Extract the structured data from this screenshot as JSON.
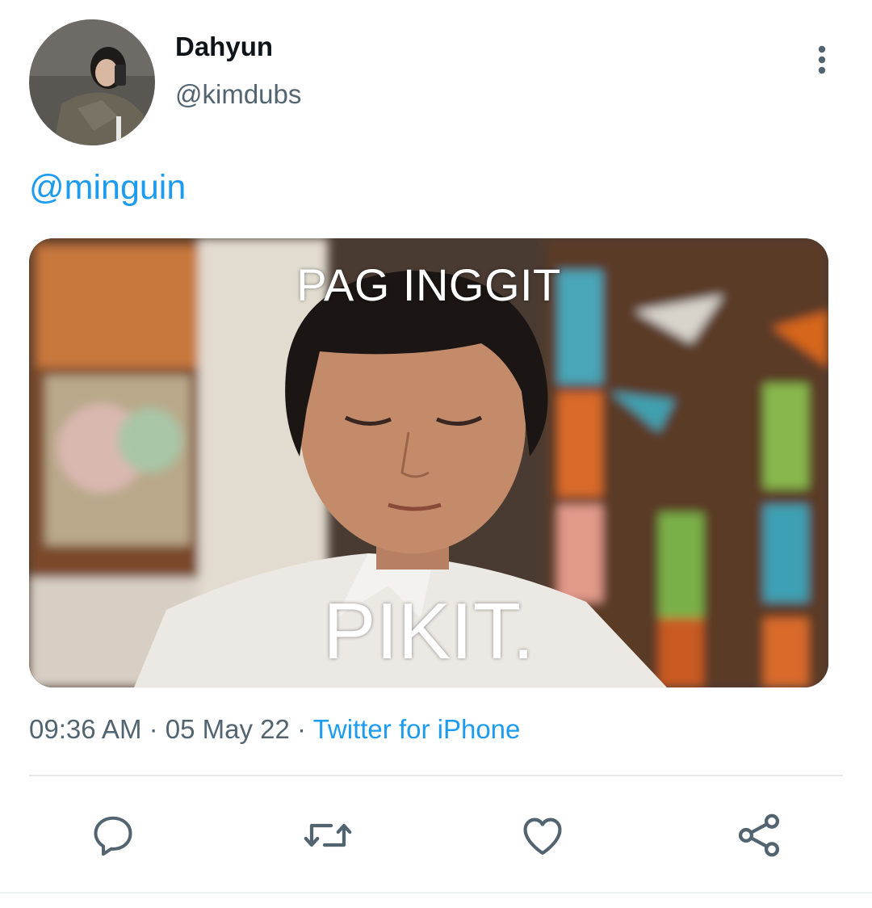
{
  "user": {
    "display_name": "Dahyun",
    "handle": "@kimdubs"
  },
  "tweet": {
    "text": "@minguin"
  },
  "media": {
    "caption_top": "PAG INGGIT",
    "caption_bottom": "PIKIT."
  },
  "meta": {
    "time": "09:36 AM",
    "sep1": " · ",
    "date": "05 May 22",
    "sep2": " · ",
    "source": "Twitter for iPhone"
  },
  "icons": {
    "more": "more-vertical-icon",
    "reply": "reply-icon",
    "retweet": "retweet-icon",
    "like": "like-icon",
    "share": "share-icon"
  },
  "colors": {
    "link": "#1d9bf0",
    "secondary_text": "#536471",
    "icon": "#536471",
    "primary_text": "#0f1419"
  }
}
